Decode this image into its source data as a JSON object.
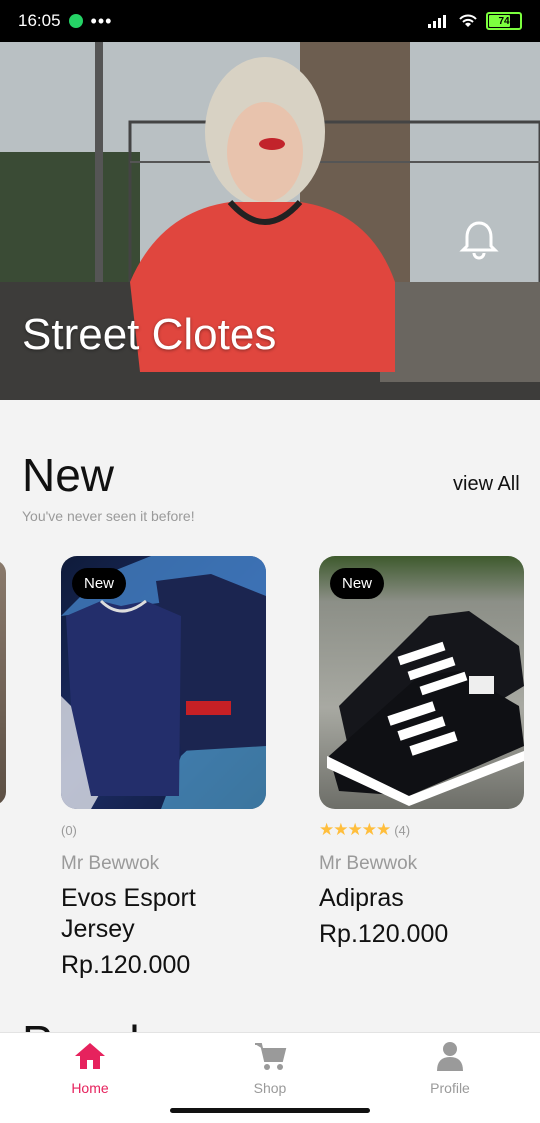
{
  "status_bar": {
    "time": "16:05",
    "battery": "74",
    "battery_level": 0.74
  },
  "hero": {
    "title": "Street Clotes"
  },
  "new_section": {
    "title": "New",
    "subtitle": "You've never seen it before!",
    "view_all": "view All"
  },
  "products": [
    {
      "badge": "New",
      "rating_count": "(0)",
      "stars": 0,
      "seller": "Mr Bewwok",
      "name": "Evos Esport Jersey",
      "price": "Rp.120.000"
    },
    {
      "badge": "New",
      "rating_count": "(4)",
      "stars": 5,
      "seller": "Mr Bewwok",
      "name": "Adipras",
      "price": "Rp.120.000"
    }
  ],
  "next_section": {
    "title": "Popular"
  },
  "nav": {
    "items": [
      {
        "label": "Home",
        "icon": "home-icon",
        "active": true
      },
      {
        "label": "Shop",
        "icon": "cart-icon",
        "active": false
      },
      {
        "label": "Profile",
        "icon": "profile-icon",
        "active": false
      }
    ],
    "active_color": "#e6225d",
    "inactive_color": "#9a9a9a"
  }
}
